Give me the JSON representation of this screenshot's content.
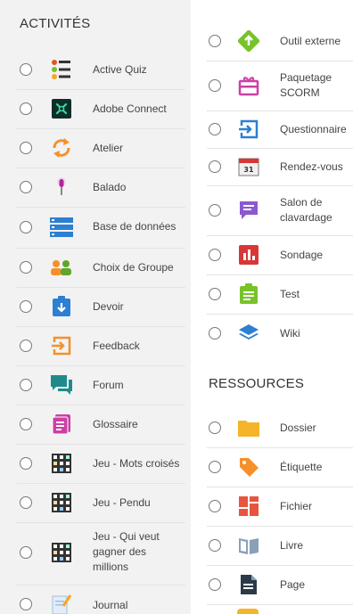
{
  "activites": {
    "title": "ACTIVITÉS",
    "items": [
      {
        "label": "Active Quiz",
        "icon": "active-quiz-icon"
      },
      {
        "label": "Adobe Connect",
        "icon": "adobe-connect-icon"
      },
      {
        "label": "Atelier",
        "icon": "atelier-icon"
      },
      {
        "label": "Balado",
        "icon": "balado-icon"
      },
      {
        "label": "Base de données",
        "icon": "base-de-donnees-icon"
      },
      {
        "label": "Choix de Groupe",
        "icon": "choix-de-groupe-icon"
      },
      {
        "label": "Devoir",
        "icon": "devoir-icon"
      },
      {
        "label": "Feedback",
        "icon": "feedback-icon"
      },
      {
        "label": "Forum",
        "icon": "forum-icon"
      },
      {
        "label": "Glossaire",
        "icon": "glossaire-icon"
      },
      {
        "label": "Jeu - Mots croisés",
        "icon": "jeu-icon"
      },
      {
        "label": "Jeu - Pendu",
        "icon": "jeu-icon"
      },
      {
        "label": "Jeu - Qui veut gagner des millions",
        "icon": "jeu-icon"
      },
      {
        "label": "Journal",
        "icon": "journal-icon"
      }
    ]
  },
  "activites_suite": {
    "items": [
      {
        "label": "Outil externe",
        "icon": "outil-externe-icon"
      },
      {
        "label": "Paquetage SCORM",
        "icon": "paquetage-scorm-icon"
      },
      {
        "label": "Questionnaire",
        "icon": "questionnaire-icon"
      },
      {
        "label": "Rendez-vous",
        "icon": "rendez-vous-icon",
        "icon_text": "31"
      },
      {
        "label": "Salon de clavardage",
        "icon": "salon-de-clavardage-icon"
      },
      {
        "label": "Sondage",
        "icon": "sondage-icon"
      },
      {
        "label": "Test",
        "icon": "test-icon"
      },
      {
        "label": "Wiki",
        "icon": "wiki-icon"
      }
    ]
  },
  "ressources": {
    "title": "RESSOURCES",
    "items": [
      {
        "label": "Dossier",
        "icon": "dossier-icon"
      },
      {
        "label": "Étiquette",
        "icon": "etiquette-icon"
      },
      {
        "label": "Fichier",
        "icon": "fichier-icon"
      },
      {
        "label": "Livre",
        "icon": "livre-icon"
      },
      {
        "label": "Page",
        "icon": "page-icon"
      }
    ]
  },
  "colors": {
    "left_bg": "#f2f2f2",
    "green": "#79c22a",
    "blue": "#2d7fd1",
    "orange": "#f5902a",
    "pink": "#cc3fa6",
    "purple": "#8a5ad0",
    "red": "#d93636"
  }
}
